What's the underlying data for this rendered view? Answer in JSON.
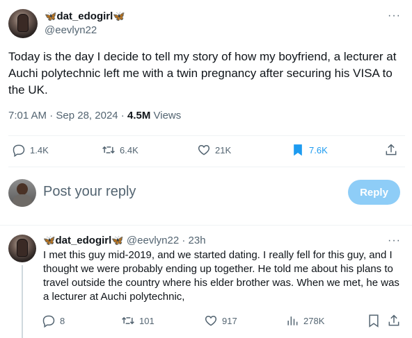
{
  "tweet": {
    "display_name": "dat_edogirl",
    "handle": "@eevlyn22",
    "more": "···",
    "text": "Today is the day I decide to tell my story of how my boyfriend, a lecturer at Auchi polytechnic left me with a twin pregnancy after securing his VISA to the UK.",
    "time": "7:01 AM",
    "date": "Sep 28, 2024",
    "views_count": "4.5M",
    "views_label": "Views",
    "replies": "1.4K",
    "reposts": "6.4K",
    "likes": "21K",
    "bookmarks": "7.6K",
    "bookmark_color": "#1d9bf0"
  },
  "compose": {
    "placeholder": "Post your reply",
    "button_label": "Reply",
    "button_color": "#8ecdf7"
  },
  "reply": {
    "display_name": "dat_edogirl",
    "handle": "@eevlyn22",
    "age": "23h",
    "more": "···",
    "text": "I met this guy mid-2019, and we started dating. I really fell for this guy, and I thought we were probably ending up together. He told me about his plans to travel outside the country where his elder brother was. When we met, he was a lecturer at Auchi polytechnic,",
    "replies": "8",
    "reposts": "101",
    "likes": "917",
    "views": "278K"
  },
  "icons": {
    "butterfly": "🦋",
    "reply": "reply-icon",
    "repost": "repost-icon",
    "like": "heart-icon",
    "bookmark": "bookmark-icon",
    "share": "share-icon",
    "views": "views-icon"
  }
}
